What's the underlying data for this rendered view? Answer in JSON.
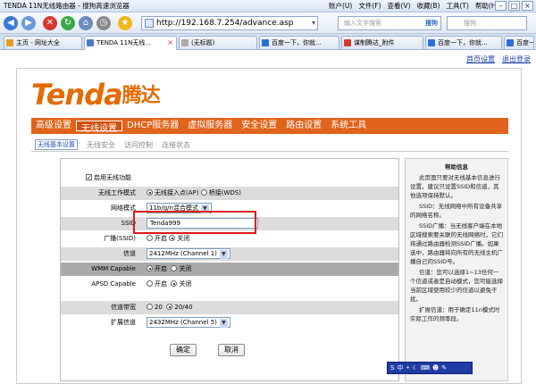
{
  "window": {
    "title": "TENDA 11N无线路由器 - 搜狗高速浏览器",
    "menus": [
      "账户(U)",
      "文件(F)",
      "查看(V)",
      "收藏(B)",
      "工具(T)",
      "帮助(H)"
    ]
  },
  "toolbar": {
    "address": "http://192.168.7.254/advance.asp",
    "search_placeholder": "输入文字搜索",
    "search_engine": "搜狗",
    "search2_placeholder": "搜狗"
  },
  "tabs": [
    {
      "label": "主页 - 网址大全"
    },
    {
      "label": "TENDA 11N无线..."
    },
    {
      "label": "(无标题)"
    },
    {
      "label": "百度一下，你就..."
    },
    {
      "label": "谋制腾达_附件"
    },
    {
      "label": "百度一下，你就..."
    },
    {
      "label": "百度一下，你就..."
    }
  ],
  "top_links": {
    "home": "首页设置",
    "logout": "退出登录"
  },
  "logo": {
    "brand": "Tenda",
    "cn": "腾达"
  },
  "main_nav": [
    "高级设置",
    "无线设置",
    "DHCP服务器",
    "虚拟服务器",
    "安全设置",
    "路由设置",
    "系统工具"
  ],
  "sub_nav": [
    "无线基本设置",
    "无线安全",
    "访问控制",
    "连接状态"
  ],
  "form": {
    "enable_label": "启用无线功能",
    "mode_label": "无线工作模式",
    "mode_ap": "无线接入点(AP)",
    "mode_wds": "桥接(WDS)",
    "netmode_label": "网络模式",
    "netmode_value": "11b/g/n混合模式",
    "ssid_label": "SSID",
    "ssid_value": "Tenda999",
    "broadcast_label": "广播(SSID)",
    "on": "开启",
    "off": "关闭",
    "channel_label": "信道",
    "channel_value": "2412MHz (Channel 1)",
    "wmm_label": "WMM Capable",
    "apsd_label": "APSD Capable",
    "bw_label": "信道带宽",
    "bw_20": "20",
    "bw_2040": "20/40",
    "ext_label": "扩展信道",
    "ext_value": "2432MHz (Channel 5)",
    "ok": "确定",
    "cancel": "取消"
  },
  "help": {
    "title": "帮助信息",
    "p1": "此页面只要对无线基本信息进行设置，建议只设置SSID和信道，其他选项保持默认。",
    "p2": "SSID：无线网络中所有设备共享的网络名称。",
    "p3": "SSID广播：当无线客户端在本地区域搜索要关联的无线网络时，它们将通过路由器检测SSID广播。如果选中，路由器将向所有的无线主机广播自己的SSID号。",
    "p4": "信道：您可以选择1~13任何一个信道或者是自动模式，您可能选择当前区域使用较少的信道以避免干扰。",
    "p5": "扩展信道：用于确定11n模式时实际工作的频率段。"
  },
  "colors": {
    "brand_orange": "#e0641c",
    "highlight_red": "#e01818"
  }
}
